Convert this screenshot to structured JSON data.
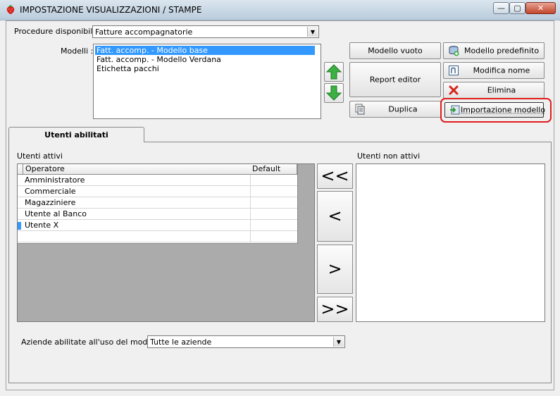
{
  "window": {
    "title": "IMPOSTAZIONE VISUALIZZAZIONI / STAMPE",
    "controls": {
      "minimize": "—",
      "maximize": "▢",
      "close": "✕"
    }
  },
  "procedure": {
    "label": "Procedure disponibili :",
    "selected": "Fatture accompagnatorie"
  },
  "modelli": {
    "label": "Modelli :",
    "items": [
      "Fatt. accomp. - Modello base",
      "Fatt. accomp. - Modello Verdana",
      "Etichetta pacchi"
    ],
    "selected_index": 0
  },
  "buttons": {
    "modello_vuoto": "Modello vuoto",
    "report_editor": "Report editor",
    "duplica": "Duplica",
    "modello_predefinito": "Modello predefinito",
    "modifica_nome": "Modifica nome",
    "elimina": "Elimina",
    "importazione_modello": "Importazione modello"
  },
  "tab": {
    "label": "Utenti abilitati"
  },
  "utenti_attivi": {
    "label": "Utenti attivi",
    "columns": [
      "Operatore",
      "Default"
    ],
    "rows": [
      "Amministratore",
      "Commerciale",
      "Magazziniere",
      "Utente al Banco",
      "Utente X"
    ]
  },
  "utenti_non_attivi": {
    "label": "Utenti non attivi"
  },
  "move_buttons": {
    "all_left": "<<",
    "left": "<",
    "right": ">",
    "all_right": ">>"
  },
  "aziende": {
    "label": "Aziende abilitate all'uso del modello :",
    "selected": "Tutte le aziende"
  },
  "colors": {
    "selection": "#3399ff",
    "highlight": "#e21b1b",
    "arrow_green": "#3cb043"
  }
}
